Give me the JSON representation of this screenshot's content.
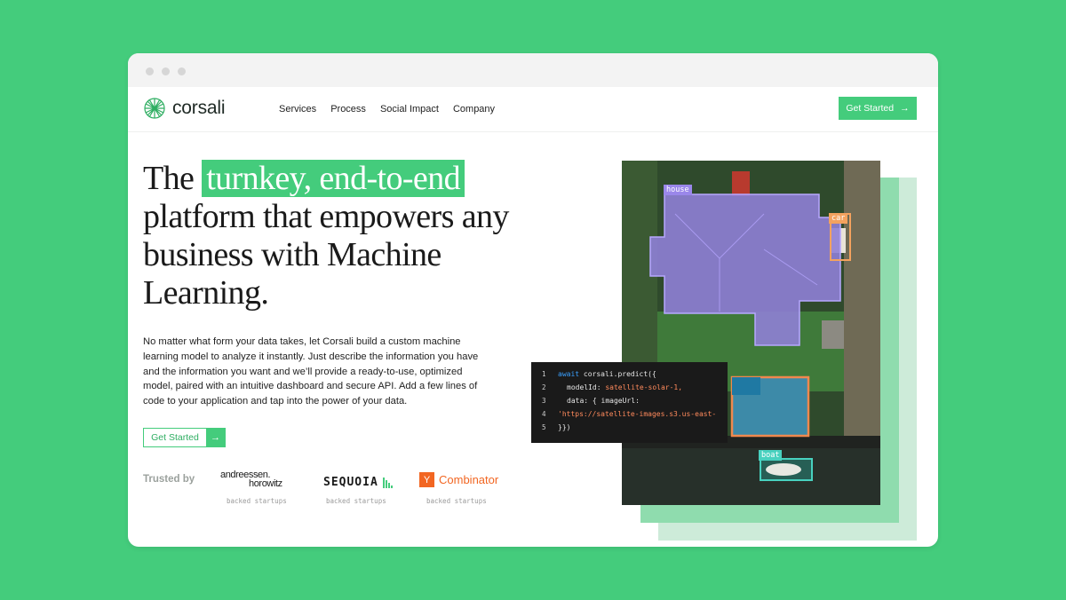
{
  "nav": {
    "logo_text": "corsali",
    "links": [
      "Services",
      "Process",
      "Social Impact",
      "Company"
    ],
    "cta": "Get Started"
  },
  "hero": {
    "headline_pre": "The ",
    "headline_highlight": "turnkey, end-to-end",
    "headline_post": " platform that empowers any business with Machine Learning.",
    "paragraph": "No matter what form your data takes, let Corsali build a custom machine learning model to analyze it instantly. Just describe the information you have and the information you want and we’ll provide a ready-to-use, optimized model, paired with an intuitive dashboard and secure API. Add a few lines of code to your application and tap into the power of your data.",
    "cta": "Get Started"
  },
  "trusted": {
    "label": "Trusted by",
    "brands": [
      {
        "line1": "andreessen.",
        "line2": "horowitz",
        "sub": "backed startups"
      },
      {
        "name": "SEQUOIA",
        "sub": "backed startups"
      },
      {
        "mark": "Y",
        "name": "Combinator",
        "sub": "backed startups"
      }
    ]
  },
  "image": {
    "labels": {
      "house": "house",
      "car": "car",
      "boat": "boat"
    },
    "colors": {
      "house": "#9a87ea",
      "car": "#f3a25f",
      "pool": "#f0884e",
      "boat": "#48d1bf"
    }
  },
  "code": {
    "line_numbers": [
      "1",
      "2",
      "3",
      "4",
      "5"
    ],
    "l1_kw": "await",
    "l1_rest": " corsali.predict({",
    "l2_key": "modelId: ",
    "l2_val": "satellite-solar-1,",
    "l3": "data: { imageUrl:",
    "l4": "'https://satellite-images.s3.us-east-",
    "l5": "}})"
  },
  "colors": {
    "brand": "#44cc7c",
    "dark": "#1a1a1a",
    "yc": "#f26622"
  }
}
